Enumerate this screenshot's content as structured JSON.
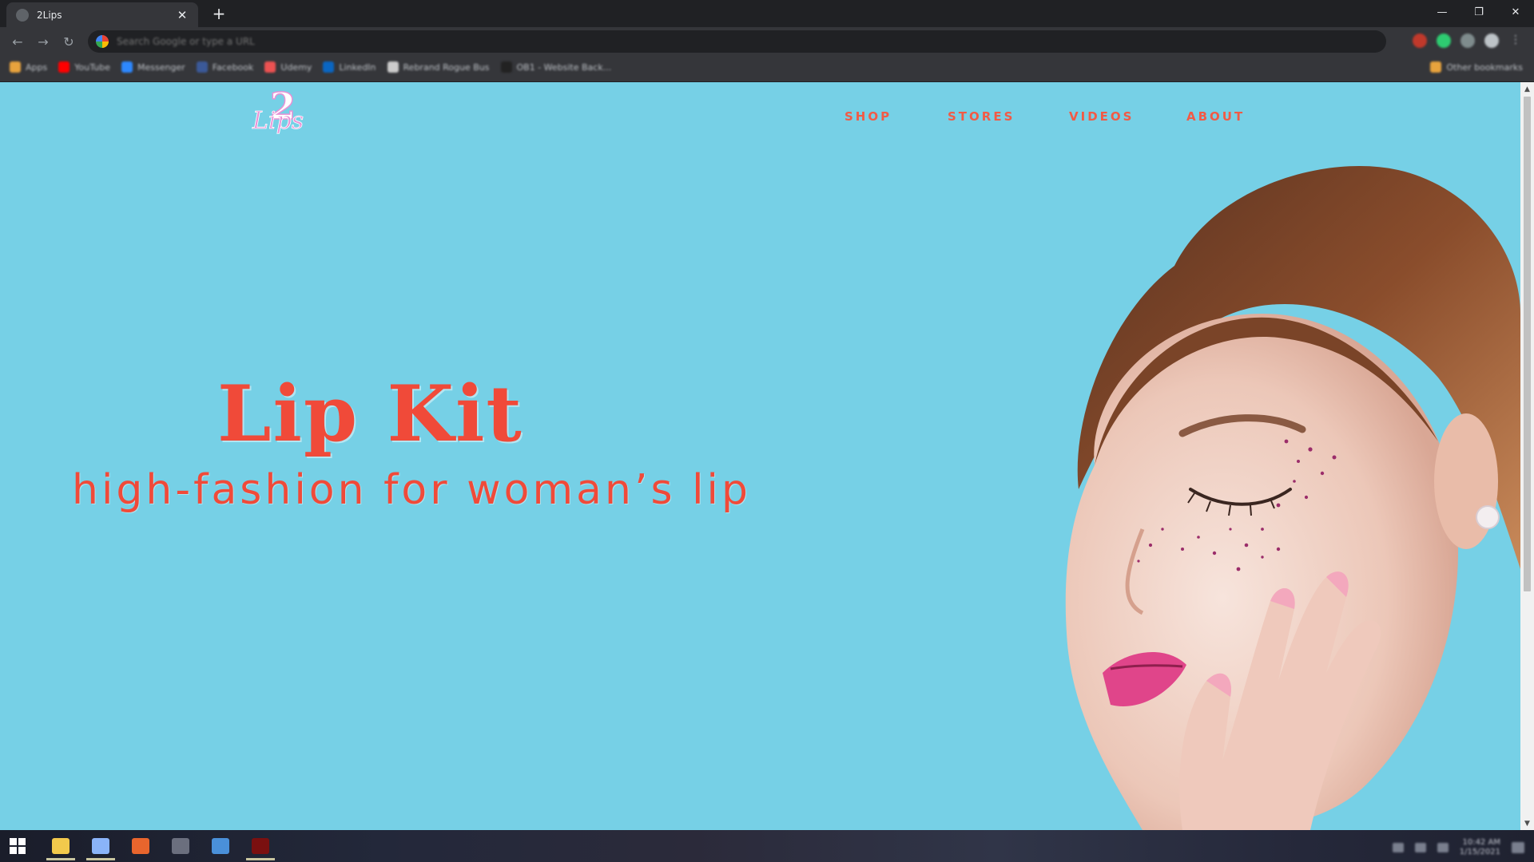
{
  "browser": {
    "tab_title": "2Lips",
    "tab_close": "✕",
    "new_tab": "+",
    "window_controls": {
      "minimize": "—",
      "restore": "❐",
      "close": "✕"
    },
    "nav": {
      "back": "←",
      "forward": "→",
      "reload": "↻"
    },
    "omnibox_placeholder": "Search Google or type a URL",
    "bookmarks": [
      {
        "label": "Apps",
        "color": "#e8a33d"
      },
      {
        "label": "YouTube",
        "color": "#ff0000"
      },
      {
        "label": "Messenger",
        "color": "#2d88ff"
      },
      {
        "label": "Facebook",
        "color": "#3b5998"
      },
      {
        "label": "Udemy",
        "color": "#ec5252"
      },
      {
        "label": "LinkedIn",
        "color": "#0a66c2"
      },
      {
        "label": "Rebrand Rogue Bus",
        "color": "#cccccc"
      },
      {
        "label": "OB1 - Website Back...",
        "color": "#222222"
      }
    ],
    "other_bookmarks": "Other bookmarks"
  },
  "site": {
    "logo_text": "2 Lips",
    "nav": [
      {
        "label": "SHOP"
      },
      {
        "label": "STORES"
      },
      {
        "label": "VIDEOS"
      },
      {
        "label": "ABOUT"
      }
    ],
    "hero": {
      "title": "Lip Kit",
      "subtitle": "high-fashion for woman’s lip"
    },
    "colors": {
      "background": "#76d0e6",
      "accent": "#f04a39",
      "logo_pink": "#e891d6"
    }
  },
  "taskbar": {
    "apps": [
      {
        "name": "file-explorer",
        "color": "#f2c94c",
        "active": true
      },
      {
        "name": "chrome",
        "color": "#8ab4f8",
        "active": true
      },
      {
        "name": "firefox",
        "color": "#e8652d",
        "active": false
      },
      {
        "name": "lightbulb",
        "color": "#6b6f7e",
        "active": false
      },
      {
        "name": "vscode",
        "color": "#4a90d9",
        "active": false
      },
      {
        "name": "adobe",
        "color": "#7a1010",
        "active": true
      }
    ],
    "clock_time": "10:42 AM",
    "clock_date": "1/15/2021"
  }
}
